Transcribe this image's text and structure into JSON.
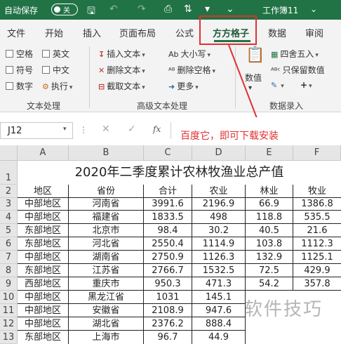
{
  "titlebar": {
    "autosave_label": "自动保存",
    "toggle_label": "关",
    "workbook_title": "工作簿11",
    "title_caret": "⌄"
  },
  "tabs": [
    "文件",
    "开始",
    "插入",
    "页面布局",
    "公式",
    "方方格子",
    "数据",
    "审阅"
  ],
  "ribbon": {
    "text_process": {
      "checkboxes": [
        "空格",
        "英文",
        "符号",
        "中文",
        "数字"
      ],
      "exec_label": "执行",
      "group_label": "文本处理"
    },
    "advanced_text": {
      "insert_text": "插入文本",
      "delete_text": "删除文本",
      "extract_text": "截取文本",
      "size_label": "大小写",
      "delete_space": "删除空格",
      "more": "更多",
      "group_label": "高级文本处理"
    },
    "numeric": {
      "value_label": "数值",
      "round_label": "四舍五入",
      "keep_value": "只保留数值",
      "group_label": "数据录入"
    }
  },
  "formula_bar": {
    "name_box": "J12",
    "fx": "fx",
    "annotation": "百度它，即可下载安装"
  },
  "sheet": {
    "columns": [
      "A",
      "B",
      "C",
      "D",
      "E",
      "F"
    ],
    "row_numbers": [
      "1",
      "2",
      "3",
      "4",
      "5",
      "6",
      "7",
      "8",
      "9",
      "10",
      "11",
      "12",
      "13"
    ],
    "title": "2020年二季度累计农林牧渔业总产值",
    "headers": [
      "地区",
      "省份",
      "合计",
      "农业",
      "林业",
      "牧业"
    ],
    "rows": [
      [
        "中部地区",
        "河南省",
        "3991.6",
        "2196.9",
        "66.9",
        "1386.8"
      ],
      [
        "中部地区",
        "福建省",
        "1833.5",
        "498",
        "118.8",
        "535.5"
      ],
      [
        "东部地区",
        "北京市",
        "98.4",
        "30.2",
        "40.5",
        "21.6"
      ],
      [
        "东部地区",
        "河北省",
        "2550.4",
        "1114.9",
        "103.8",
        "1112.3"
      ],
      [
        "中部地区",
        "湖南省",
        "2750.9",
        "1126.3",
        "132.9",
        "1125.1"
      ],
      [
        "东部地区",
        "江苏省",
        "2766.7",
        "1532.5",
        "72.5",
        "429.9"
      ],
      [
        "西部地区",
        "重庆市",
        "950.3",
        "471.3",
        "54.2",
        "357.8"
      ],
      [
        "中部地区",
        "黑龙江省",
        "1031",
        "145.1",
        "",
        ""
      ],
      [
        "中部地区",
        "安徽省",
        "2108.9",
        "947.6",
        "",
        ""
      ],
      [
        "中部地区",
        "湖北省",
        "2376.2",
        "888.4",
        "",
        ""
      ],
      [
        "东部地区",
        "上海市",
        "96.7",
        "44.9",
        "",
        ""
      ]
    ]
  },
  "watermark": "软件技巧",
  "colors": {
    "accent": "#217346",
    "annotation": "#e03030"
  }
}
